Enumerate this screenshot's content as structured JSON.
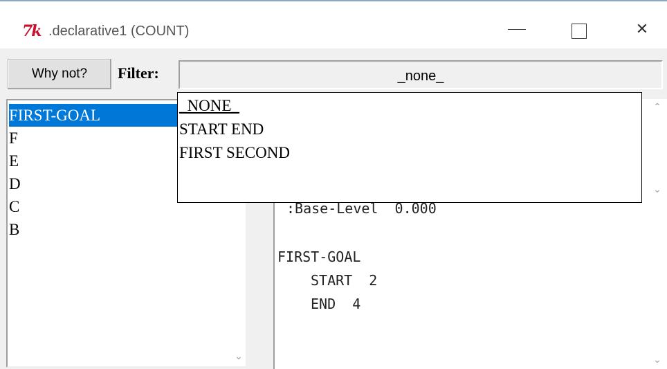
{
  "window": {
    "icon_text": "7k",
    "title": ".declarative1 (COUNT)",
    "minimize_icon": "minimize-icon",
    "maximize_icon": "maximize-icon",
    "close_icon": "close-icon",
    "close_glyph": "✕"
  },
  "toolbar": {
    "why_not_label": "Why not?",
    "filter_label": "Filter:",
    "filter_value": "_none_"
  },
  "filter_options": [
    "_NONE_",
    "START END",
    "FIRST SECOND"
  ],
  "chunks": [
    "FIRST-GOAL",
    "F",
    "E",
    "D",
    "C",
    "B"
  ],
  "selected_chunk": "FIRST-GOAL",
  "chunk_details": {
    "base_level_line": ":Base-Level  0.000",
    "chunk_name": "FIRST-GOAL",
    "slot_lines": [
      "START  2",
      "END  4"
    ]
  },
  "colors": {
    "selection": "#0078d7",
    "icon_red": "#c8102e"
  }
}
